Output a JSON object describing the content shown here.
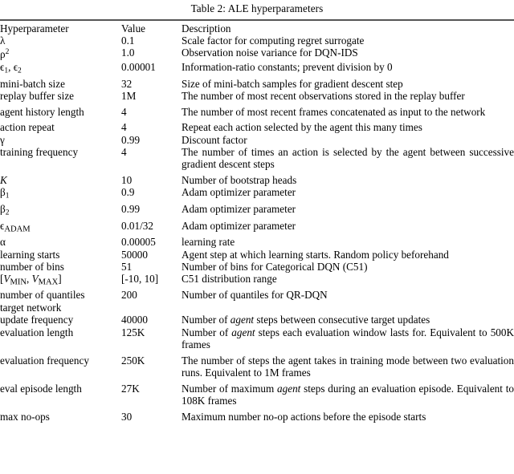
{
  "caption": "Table 2: ALE hyperparameters",
  "columns": {
    "name": "Hyperparameter",
    "value": "Value",
    "description": "Description"
  },
  "rows": [
    {
      "name_kind": "math",
      "name_plain": "λ",
      "value": "0.1",
      "description": "Scale factor for computing regret surrogate"
    },
    {
      "name_kind": "math",
      "name_plain": "ρ²",
      "value": "1.0",
      "description": "Observation noise variance for DQN-IDS"
    },
    {
      "name_kind": "math",
      "name_plain": "ϵ₁, ϵ₂",
      "value": "0.00001",
      "description": "Information-ratio constants; prevent division by 0"
    },
    {
      "name_kind": "text",
      "name_plain": "mini-batch size",
      "value": "32",
      "description": "Size of mini-batch samples for gradient descent step"
    },
    {
      "name_kind": "text",
      "name_plain": "replay buffer size",
      "value": "1M",
      "description": "The number of most recent observations stored in the replay buffer"
    },
    {
      "name_kind": "text",
      "name_plain": "agent history length",
      "value": "4",
      "description": "The number of most recent frames concatenated as input to the network"
    },
    {
      "name_kind": "text",
      "name_plain": "action repeat",
      "value": "4",
      "description": "Repeat each action selected by the agent this many times"
    },
    {
      "name_kind": "math",
      "name_plain": "γ",
      "value": "0.99",
      "description": "Discount factor"
    },
    {
      "name_kind": "text",
      "name_plain": "training frequency",
      "value": "4",
      "description": "The number of times an action is selected by the agent between successive gradient descent steps"
    },
    {
      "name_kind": "math",
      "name_plain": "K",
      "value": "10",
      "description": "Number of bootstrap heads"
    },
    {
      "name_kind": "math",
      "name_plain": "β₁",
      "value": "0.9",
      "description": "Adam optimizer parameter"
    },
    {
      "name_kind": "math",
      "name_plain": "β₂",
      "value": "0.99",
      "description": "Adam optimizer parameter"
    },
    {
      "name_kind": "math",
      "name_plain": "ϵADAM",
      "value": "0.01/32",
      "description": "Adam optimizer parameter"
    },
    {
      "name_kind": "math",
      "name_plain": "α",
      "value": "0.00005",
      "description": "learning rate"
    },
    {
      "name_kind": "text",
      "name_plain": "learning starts",
      "value": "50000",
      "description": "Agent step at which learning starts. Random policy beforehand"
    },
    {
      "name_kind": "text",
      "name_plain": "number of bins",
      "value": "51",
      "description": "Number of bins for Categorical DQN (C51)"
    },
    {
      "name_kind": "math",
      "name_plain": "[VMIN, VMAX]",
      "value": "[-10, 10]",
      "description": "C51 distribution range"
    },
    {
      "name_kind": "text",
      "name_plain": "number of quantiles",
      "value": "200",
      "description": "Number of quantiles for QR-DQN"
    },
    {
      "name_kind": "text",
      "name_plain": "target network update frequency",
      "value": "40000",
      "description": "Number of agent steps between consecutive target updates"
    },
    {
      "name_kind": "text",
      "name_plain": "evaluation length",
      "value": "125K",
      "description": "Number of agent steps each evaluation window lasts for. Equivalent to 500K frames"
    },
    {
      "name_kind": "text",
      "name_plain": "evaluation frequency",
      "value": "250K",
      "description": "The number of steps the agent takes in training mode between two evaluation runs. Equivalent to 1M frames"
    },
    {
      "name_kind": "text",
      "name_plain": "eval episode length",
      "value": "27K",
      "description": "Number of maximum agent steps during an evaluation episode. Equivalent to 108K frames"
    },
    {
      "name_kind": "text",
      "name_plain": "max no-ops",
      "value": "30",
      "description": "Maximum number no-op actions before the episode starts"
    }
  ]
}
